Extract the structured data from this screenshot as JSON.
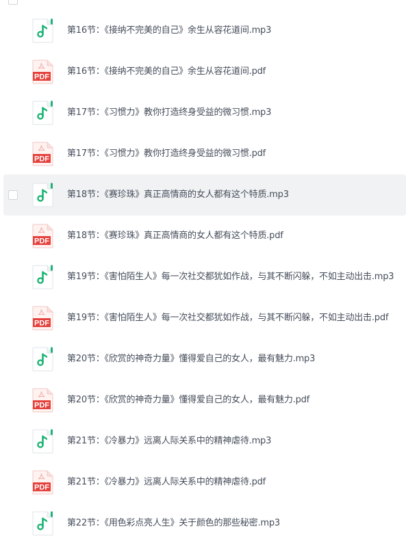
{
  "header": {
    "label": "",
    "checkbox_checked": false
  },
  "icons": {
    "audio": "music-note-icon",
    "pdf": "pdf-file-icon",
    "pdf_badge_text": "PDF",
    "audio_color": "#1ab374",
    "pdf_color": "#e5413c"
  },
  "files": [
    {
      "name": "第16节：《接纳不完美的自己》余生从容花道间.mp3",
      "type": "audio"
    },
    {
      "name": "第16节：《接纳不完美的自己》余生从容花道间.pdf",
      "type": "pdf"
    },
    {
      "name": "第17节：《习惯力》教你打造终身受益的微习惯.mp3",
      "type": "audio"
    },
    {
      "name": "第17节：《习惯力》教你打造终身受益的微习惯.pdf",
      "type": "pdf"
    },
    {
      "name": "第18节：《赛珍珠》真正高情商的女人都有这个特质.mp3",
      "type": "audio",
      "hovered": true
    },
    {
      "name": "第18节：《赛珍珠》真正高情商的女人都有这个特质.pdf",
      "type": "pdf"
    },
    {
      "name": "第19节：《害怕陌生人》每一次社交都犹如作战，与其不断闪躲，不如主动出击.mp3",
      "type": "audio"
    },
    {
      "name": "第19节：《害怕陌生人》每一次社交都犹如作战，与其不断闪躲，不如主动出击.pdf",
      "type": "pdf"
    },
    {
      "name": "第20节：《欣赏的神奇力量》懂得爱自己的女人，最有魅力.mp3",
      "type": "audio"
    },
    {
      "name": "第20节：《欣赏的神奇力量》懂得爱自己的女人，最有魅力.pdf",
      "type": "pdf"
    },
    {
      "name": "第21节：《冷暴力》远离人际关系中的精神虐待.mp3",
      "type": "audio"
    },
    {
      "name": "第21节：《冷暴力》远离人际关系中的精神虐待.pdf",
      "type": "pdf"
    },
    {
      "name": "第22节：《用色彩点亮人生》关于颜色的那些秘密.mp3",
      "type": "audio"
    }
  ]
}
